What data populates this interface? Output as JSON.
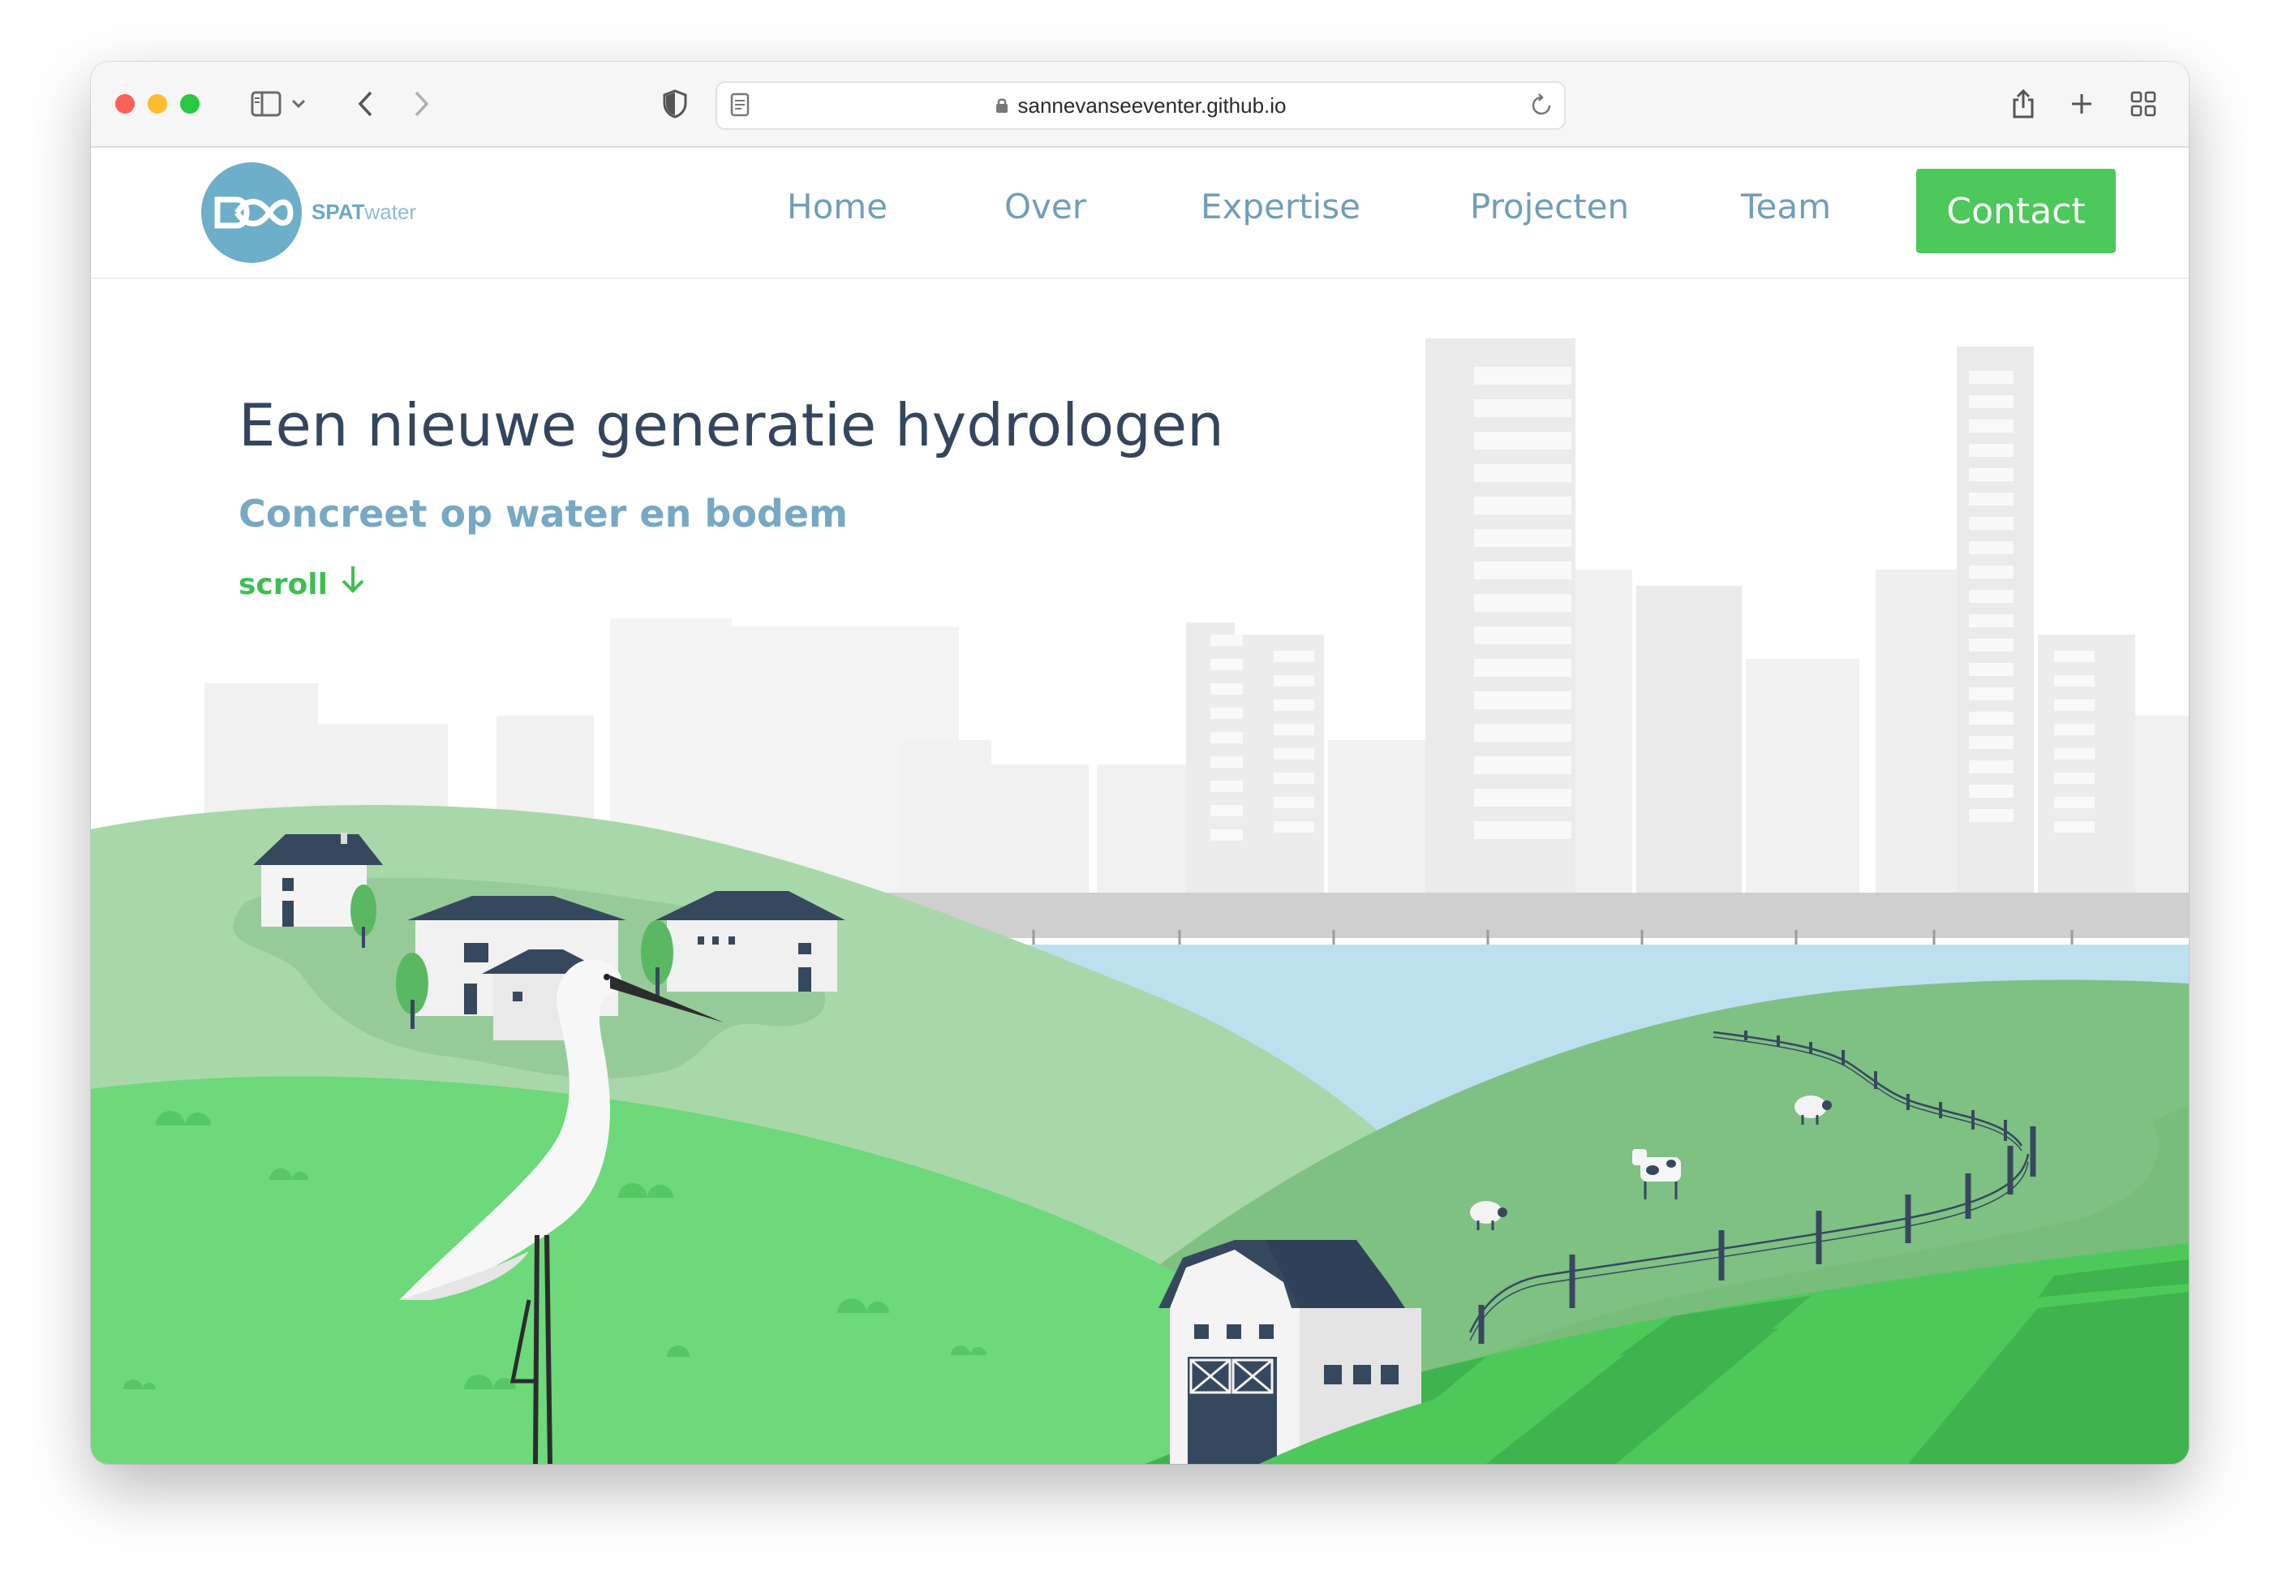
{
  "browser": {
    "url": "sannevanseeventer.github.io",
    "traffic_lights": [
      "#fe5f57",
      "#febc2e",
      "#28c840"
    ]
  },
  "nav": {
    "logo_brand": "SPAT",
    "logo_suffix": "water",
    "links": [
      "Home",
      "Over",
      "Expertise",
      "Projecten",
      "Team"
    ],
    "contact_label": "Contact"
  },
  "hero": {
    "title": "Een nieuwe generatie hydrologen",
    "subtitle": "Concreet op water en bodem",
    "scroll_label": "scroll",
    "scroll_icon": "arrow-down-icon"
  },
  "colors": {
    "accent_green": "#4cc95a",
    "title_color": "#34465e",
    "link_blue": "#6f9fb8"
  }
}
